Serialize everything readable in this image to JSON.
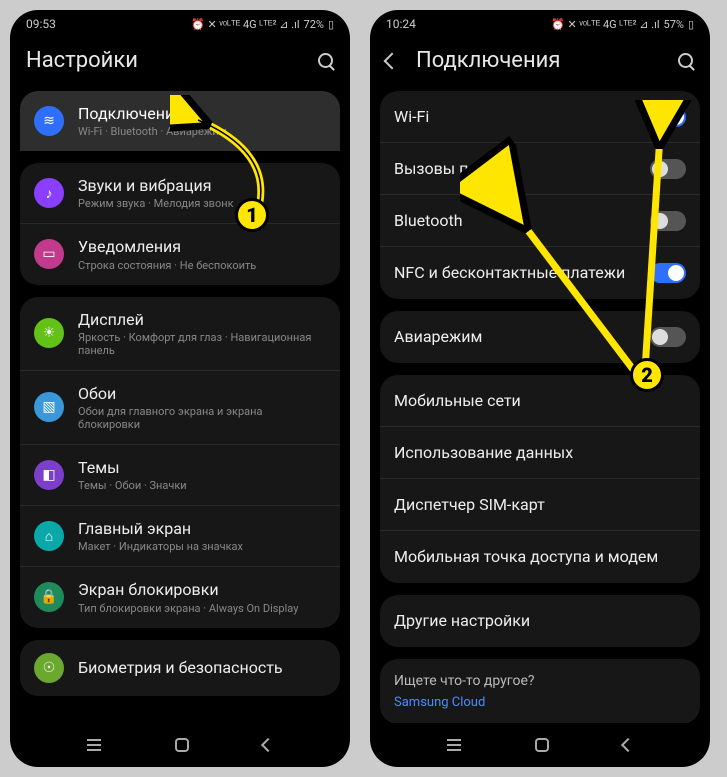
{
  "left": {
    "status": {
      "time": "09:53",
      "battery": "72%",
      "indicators": "⏰ ✕ ᵛᵒᴸᵀᴱ 4G ᴸᵀᴱ² ⊿ .ıl"
    },
    "header": {
      "title": "Настройки"
    },
    "items": [
      {
        "title": "Подключения",
        "sub": "Wi-Fi · Bluetooth · Авиарежим",
        "iconColor": "#2f6fff",
        "glyph": "≋",
        "hl": true
      },
      {
        "title": "Звуки и вибрация",
        "sub": "Режим звука · Мелодия звонк",
        "iconColor": "#8a3fff",
        "glyph": "♪"
      },
      {
        "title": "Уведомления",
        "sub": "Строка состояния · Не беспокоить",
        "iconColor": "#c23a8b",
        "glyph": "▭"
      },
      {
        "title": "Дисплей",
        "sub": "Яркость · Комфорт для глаз · Навигационная панель",
        "iconColor": "#62c217",
        "glyph": "☀"
      },
      {
        "title": "Обои",
        "sub": "Обои для главного экрана и экрана блокировки",
        "iconColor": "#3a97d9",
        "glyph": "▧"
      },
      {
        "title": "Темы",
        "sub": "Темы · Обои · Значки",
        "iconColor": "#7b3fc9",
        "glyph": "◧"
      },
      {
        "title": "Главный экран",
        "sub": "Макет · Индикаторы на значках",
        "iconColor": "#0aa8a8",
        "glyph": "⌂"
      },
      {
        "title": "Экран блокировки",
        "sub": "Тип блокировки экрана · Always On Display",
        "iconColor": "#1f8a5a",
        "glyph": "🔒"
      },
      {
        "title": "Биометрия и безопасность",
        "sub": "",
        "iconColor": "#6aa82f",
        "glyph": "☉"
      }
    ]
  },
  "right": {
    "status": {
      "time": "10:24",
      "battery": "57%",
      "indicators": "⏰ ✕ ᵛᵒᴸᵀᴱ 4G ᴸᵀᴱ² ⊿ .ıl"
    },
    "header": {
      "title": "Подключения"
    },
    "groups": [
      [
        {
          "title": "Wi-Fi",
          "toggle": true
        },
        {
          "title": "Вызовы по Wi-Fi",
          "toggle": false
        },
        {
          "title": "Bluetooth",
          "toggle": false
        },
        {
          "title": "NFC и бесконтактные платежи",
          "toggle": true
        }
      ],
      [
        {
          "title": "Авиарежим",
          "toggle": false
        }
      ],
      [
        {
          "title": "Мобильные сети"
        },
        {
          "title": "Использование данных"
        },
        {
          "title": "Диспетчер SIM-карт"
        },
        {
          "title": "Мобильная точка доступа и модем"
        }
      ],
      [
        {
          "title": "Другие настройки"
        }
      ]
    ],
    "footer": {
      "prompt": "Ищете что-то другое?",
      "link": "Samsung Cloud"
    }
  },
  "callouts": {
    "one": "1",
    "two": "2"
  }
}
